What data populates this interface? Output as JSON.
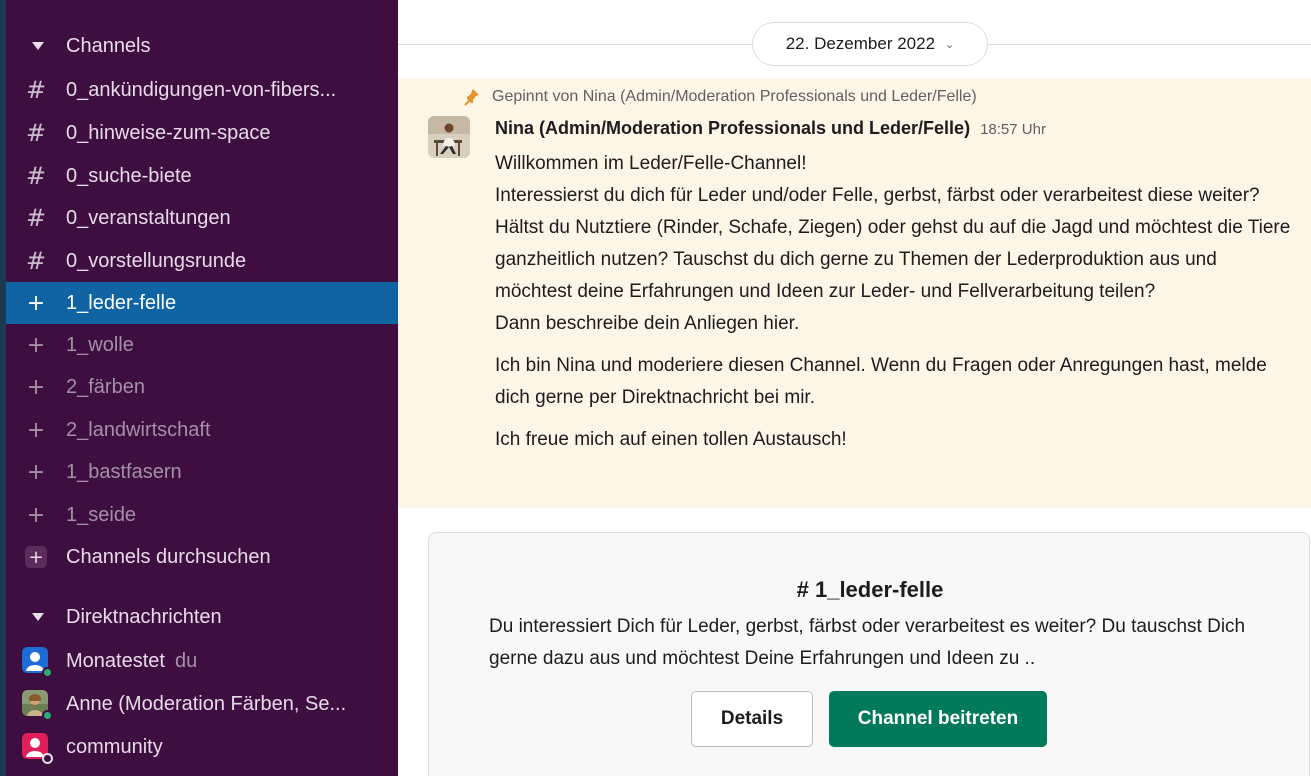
{
  "sidebar": {
    "channels_header": "Channels",
    "channels": [
      {
        "prefix": "#",
        "label": "0_ankündigungen-von-fibers..."
      },
      {
        "prefix": "#",
        "label": "0_hinweise-zum-space"
      },
      {
        "prefix": "#",
        "label": "0_suche-biete"
      },
      {
        "prefix": "#",
        "label": "0_veranstaltungen"
      },
      {
        "prefix": "#",
        "label": "0_vorstellungsrunde"
      },
      {
        "prefix": "+",
        "label": "1_leder-felle",
        "active": true
      },
      {
        "prefix": "+",
        "label": "1_wolle"
      },
      {
        "prefix": "+",
        "label": "2_färben"
      },
      {
        "prefix": "+",
        "label": "2_landwirtschaft"
      },
      {
        "prefix": "+",
        "label": "1_bastfasern"
      },
      {
        "prefix": "+",
        "label": "1_seide"
      }
    ],
    "browse_channels": "Channels durchsuchen",
    "dm_header": "Direktnachrichten",
    "dms": [
      {
        "name": "Monatestet",
        "suffix": "du",
        "status": "online"
      },
      {
        "name": "Anne (Moderation Färben, Se...",
        "status": "online"
      },
      {
        "name": "community",
        "status": "away"
      }
    ],
    "colors": {
      "background": "#3f0e40",
      "active": "#1164a3",
      "presence": "#2bac76"
    }
  },
  "main": {
    "date_label": "22. Dezember 2022",
    "pinned_by": "Gepinnt von Nina (Admin/Moderation Professionals und Leder/Felle)",
    "message": {
      "author": "Nina (Admin/Moderation Professionals und Leder/Felle)",
      "time": "18:57 Uhr",
      "line1": "Willkommen im Leder/Felle-Channel!",
      "line2": "Interessierst du dich für Leder und/oder Felle, gerbst, färbst oder verarbeitest diese weiter? Hältst du Nutztiere (Rinder, Schafe, Ziegen) oder gehst du auf die Jagd und möchtest die Tiere ganzheitlich nutzen? Tauschst du dich gerne zu Themen der Lederproduktion aus und möchtest deine Erfahrungen und Ideen zur Leder- und Fellverarbeitung teilen?",
      "line3": "Dann beschreibe dein Anliegen hier.",
      "line4": "Ich bin Nina und moderiere diesen Channel. Wenn du Fragen oder Anregungen hast, melde dich gerne per Direktnachricht bei mir.",
      "line5": "Ich freue mich auf einen tollen Austausch!"
    },
    "channel_card": {
      "title": "# 1_leder-felle",
      "description": "Du interessiert Dich für Leder, gerbst, färbst oder verarbeitest es weiter? Du tauschst Dich gerne dazu aus und möchtest Deine Erfahrungen und Ideen zu ..",
      "details_button": "Details",
      "join_button": "Channel beitreten"
    },
    "colors": {
      "pinned_bg": "#fdf6e7",
      "join_button": "#007a5a",
      "pin_icon": "#e8912d"
    }
  }
}
